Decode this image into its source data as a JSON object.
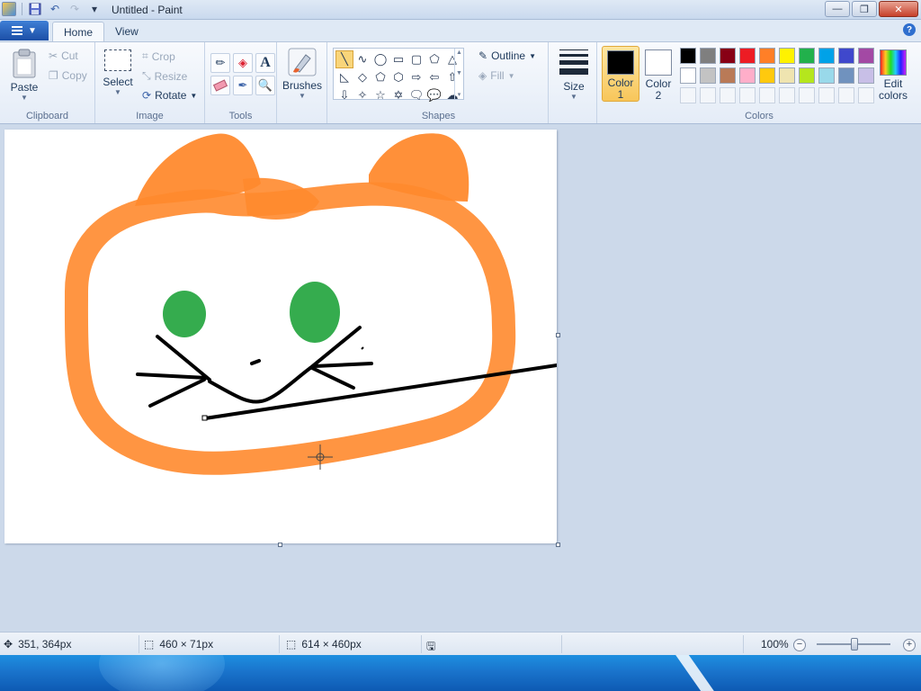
{
  "window": {
    "title": "Untitled - Paint",
    "minimize_label": "—",
    "restore_label": "❐",
    "close_label": "✕"
  },
  "quick_access": {
    "save_icon": "💾",
    "undo_icon": "↶",
    "redo_icon": "↷",
    "dropdown_icon": "▾"
  },
  "tabs": {
    "home": "Home",
    "view": "View"
  },
  "ribbon": {
    "clipboard": {
      "label": "Clipboard",
      "paste": "Paste",
      "cut": "Cut",
      "copy": "Copy"
    },
    "image": {
      "label": "Image",
      "select": "Select",
      "crop": "Crop",
      "resize": "Resize",
      "rotate": "Rotate"
    },
    "tools": {
      "label": "Tools"
    },
    "brushes": {
      "label": "Brushes"
    },
    "shapes": {
      "label": "Shapes",
      "outline": "Outline",
      "fill": "Fill"
    },
    "size": {
      "label": "Size"
    },
    "colors": {
      "label": "Colors",
      "color1_line1": "Color",
      "color1_line2": "1",
      "color2_line1": "Color",
      "color2_line2": "2",
      "edit_line1": "Edit",
      "edit_line2": "colors",
      "color1_value": "#000000",
      "color2_value": "#ffffff",
      "palette_row1": [
        "#000000",
        "#7f7f7f",
        "#880015",
        "#ed1c24",
        "#ff7f27",
        "#fff200",
        "#22b14c",
        "#00a2e8",
        "#3f48cc",
        "#a349a4"
      ],
      "palette_row2": [
        "#ffffff",
        "#c3c3c3",
        "#b97a57",
        "#ffaec9",
        "#ffc90e",
        "#efe4b0",
        "#b5e61d",
        "#99d9ea",
        "#7092be",
        "#c8bfe7"
      ]
    }
  },
  "statusbar": {
    "cursor_pos": "351, 364px",
    "selection_size": "460 × 71px",
    "image_size": "614 × 460px",
    "zoom": "100%"
  },
  "drawing": {
    "orange": "#ff8a2e",
    "green": "#2aa845",
    "line": "#000000"
  }
}
